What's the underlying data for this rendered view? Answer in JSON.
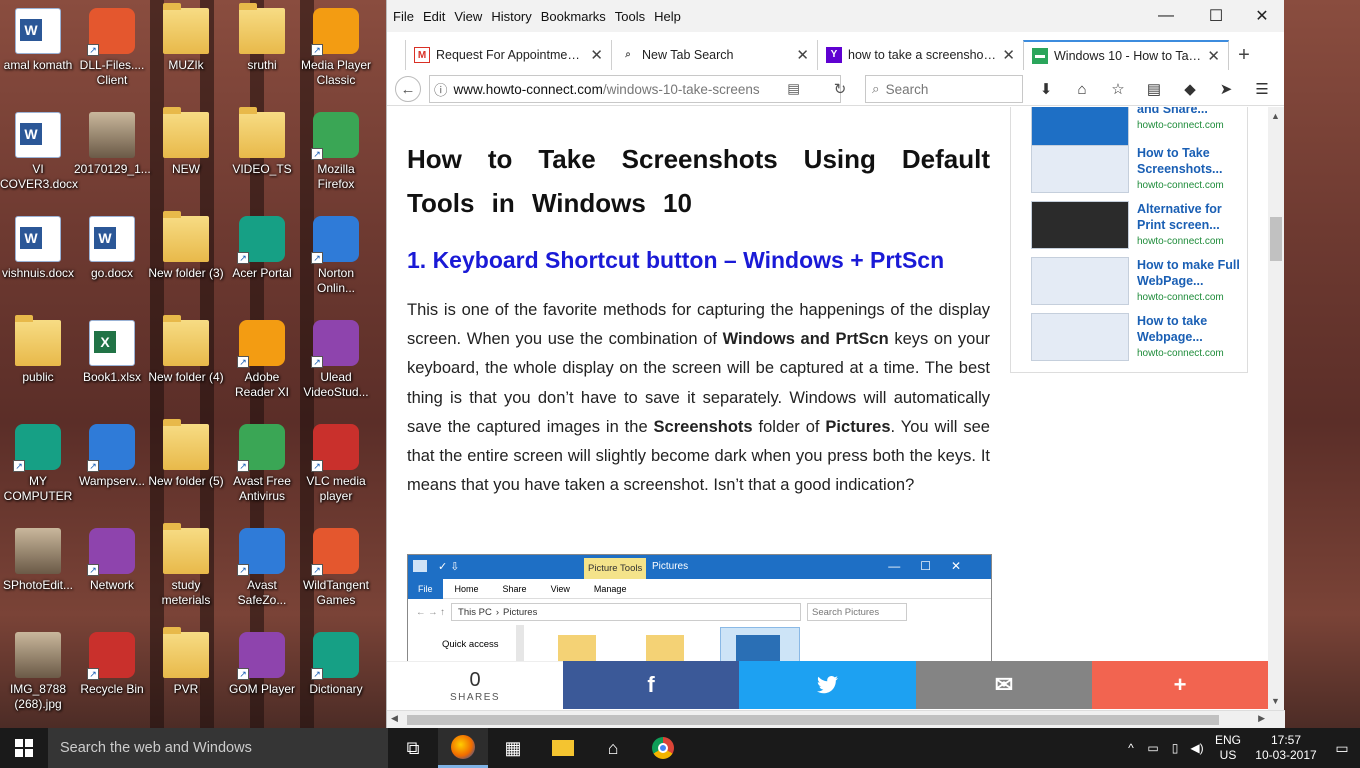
{
  "desktop": {
    "icons": [
      {
        "label": "amal komath",
        "type": "doc"
      },
      {
        "label": "DLL-Files.... Client",
        "type": "app"
      },
      {
        "label": "MUZIk",
        "type": "folder"
      },
      {
        "label": "sruthi",
        "type": "folder"
      },
      {
        "label": "Media Player Classic",
        "type": "app"
      },
      {
        "label": "VI COVER3.docx",
        "type": "doc"
      },
      {
        "label": "20170129_1...",
        "type": "image"
      },
      {
        "label": "NEW",
        "type": "folder"
      },
      {
        "label": "VIDEO_TS",
        "type": "folder"
      },
      {
        "label": "Mozilla Firefox",
        "type": "app"
      },
      {
        "label": "vishnuis.docx",
        "type": "doc"
      },
      {
        "label": "go.docx",
        "type": "doc"
      },
      {
        "label": "New folder (3)",
        "type": "folder"
      },
      {
        "label": "Acer Portal",
        "type": "app"
      },
      {
        "label": "Norton Onlin...",
        "type": "app"
      },
      {
        "label": "public",
        "type": "folder"
      },
      {
        "label": "Book1.xlsx",
        "type": "xls"
      },
      {
        "label": "New folder (4)",
        "type": "folder"
      },
      {
        "label": "Adobe Reader XI",
        "type": "app"
      },
      {
        "label": "Ulead VideoStud...",
        "type": "app"
      },
      {
        "label": "MY COMPUTER",
        "type": "app"
      },
      {
        "label": "Wampserv...",
        "type": "app"
      },
      {
        "label": "New folder (5)",
        "type": "folder"
      },
      {
        "label": "Avast Free Antivirus",
        "type": "app"
      },
      {
        "label": "VLC media player",
        "type": "app"
      },
      {
        "label": "SPhotoEdit...",
        "type": "image"
      },
      {
        "label": "Network",
        "type": "app"
      },
      {
        "label": "study meterials",
        "type": "folder"
      },
      {
        "label": "Avast SafeZo...",
        "type": "app"
      },
      {
        "label": "WildTangent Games",
        "type": "app"
      },
      {
        "label": "IMG_8788 (268).jpg",
        "type": "image"
      },
      {
        "label": "Recycle Bin",
        "type": "app"
      },
      {
        "label": "PVR",
        "type": "folder"
      },
      {
        "label": "GOM Player",
        "type": "app"
      },
      {
        "label": "Dictionary",
        "type": "app"
      }
    ]
  },
  "browser": {
    "menu": [
      "File",
      "Edit",
      "View",
      "History",
      "Bookmarks",
      "Tools",
      "Help"
    ],
    "tabs": [
      {
        "title": "Request For Appointment...",
        "active": false,
        "icon": "gmail-icon"
      },
      {
        "title": "New Tab Search",
        "active": false,
        "icon": "search-icon"
      },
      {
        "title": "how to take a screenshot ...",
        "active": false,
        "icon": "yahoo-icon"
      },
      {
        "title": "Windows 10 - How to Tak...",
        "active": true,
        "icon": "site-icon"
      }
    ],
    "url_domain": "www.howto-connect.com",
    "url_path": "/windows-10-take-screens",
    "search_placeholder": "Search"
  },
  "article": {
    "title": "How to Take Screenshots Using Default Tools in Windows 10",
    "heading": "1. Keyboard Shortcut button – Windows + PrtScn",
    "p_1": "This is one of the favorite methods for capturing the happenings of the display screen. When you use the combination of ",
    "p_b1": "Windows and PrtScn",
    "p_2": " keys on your keyboard, the whole display on the screen will be captured at a time. The best thing is that you don’t have to save it separately. Windows will automatically save the captured images in the ",
    "p_b2": "Screenshots",
    "p_3": " folder of ",
    "p_b3": "Pictures",
    "p_4": ". You will see that the entire screen will slightly become dark when you press both the keys. It means that you have taken a screenshot. Isn’t that a good indication?"
  },
  "explorer": {
    "ribbon_tab": "Picture Tools",
    "window_title": "Pictures",
    "tabs": [
      "File",
      "Home",
      "Share",
      "View",
      "Manage"
    ],
    "path": [
      "This PC",
      "Pictures"
    ],
    "search": "Search Pictures",
    "quick_access": "Quick access"
  },
  "sidebar": {
    "items": [
      {
        "title": "and Share...",
        "domain": "howto-connect.com"
      },
      {
        "title": "How to Take Screenshots...",
        "domain": "howto-connect.com"
      },
      {
        "title": "Alternative for Print screen...",
        "domain": "howto-connect.com"
      },
      {
        "title": "How to make Full WebPage...",
        "domain": "howto-connect.com"
      },
      {
        "title": "How to take Webpage...",
        "domain": "howto-connect.com"
      }
    ]
  },
  "share": {
    "count": "0",
    "label": "SHARES",
    "colors": {
      "facebook": "#3b5998",
      "twitter": "#1da1f2",
      "email": "#848484",
      "more": "#f26450"
    }
  },
  "taskbar": {
    "search": "Search the web and Windows",
    "lang_1": "ENG",
    "lang_2": "US",
    "time": "17:57",
    "date": "10-03-2017"
  }
}
